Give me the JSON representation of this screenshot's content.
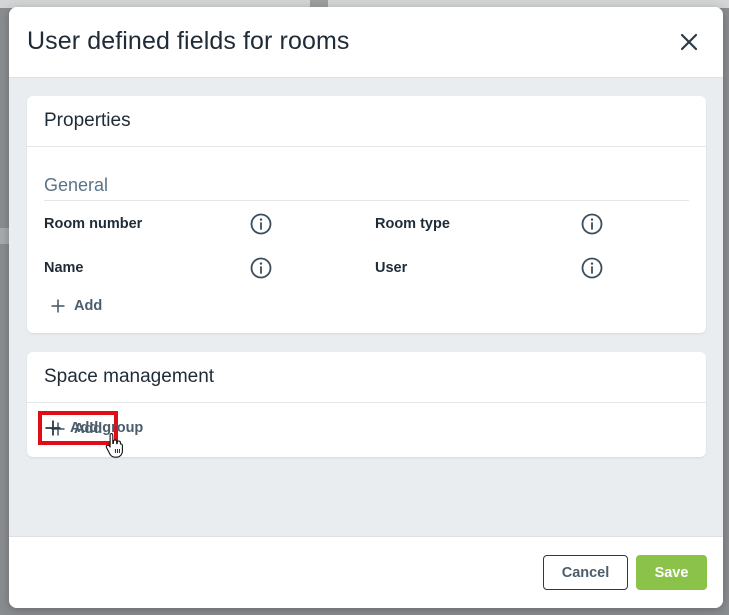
{
  "dialog": {
    "title": "User defined fields for rooms",
    "close_icon": "close-icon"
  },
  "properties_section": {
    "title": "Properties",
    "group_title": "General",
    "fields": [
      {
        "label": "Room number",
        "icon": "info-icon"
      },
      {
        "label": "Room type",
        "icon": "info-icon"
      },
      {
        "label": "Name",
        "icon": "info-icon"
      },
      {
        "label": "User",
        "icon": "info-icon"
      }
    ],
    "add_label": "Add"
  },
  "space_section": {
    "title": "Space management",
    "add_label": "Add"
  },
  "add_group_label": "Add group",
  "footer": {
    "cancel_label": "Cancel",
    "save_label": "Save"
  },
  "colors": {
    "accent_save": "#8bc34a",
    "highlight": "#e10c16",
    "body_bg": "#e9edef"
  }
}
